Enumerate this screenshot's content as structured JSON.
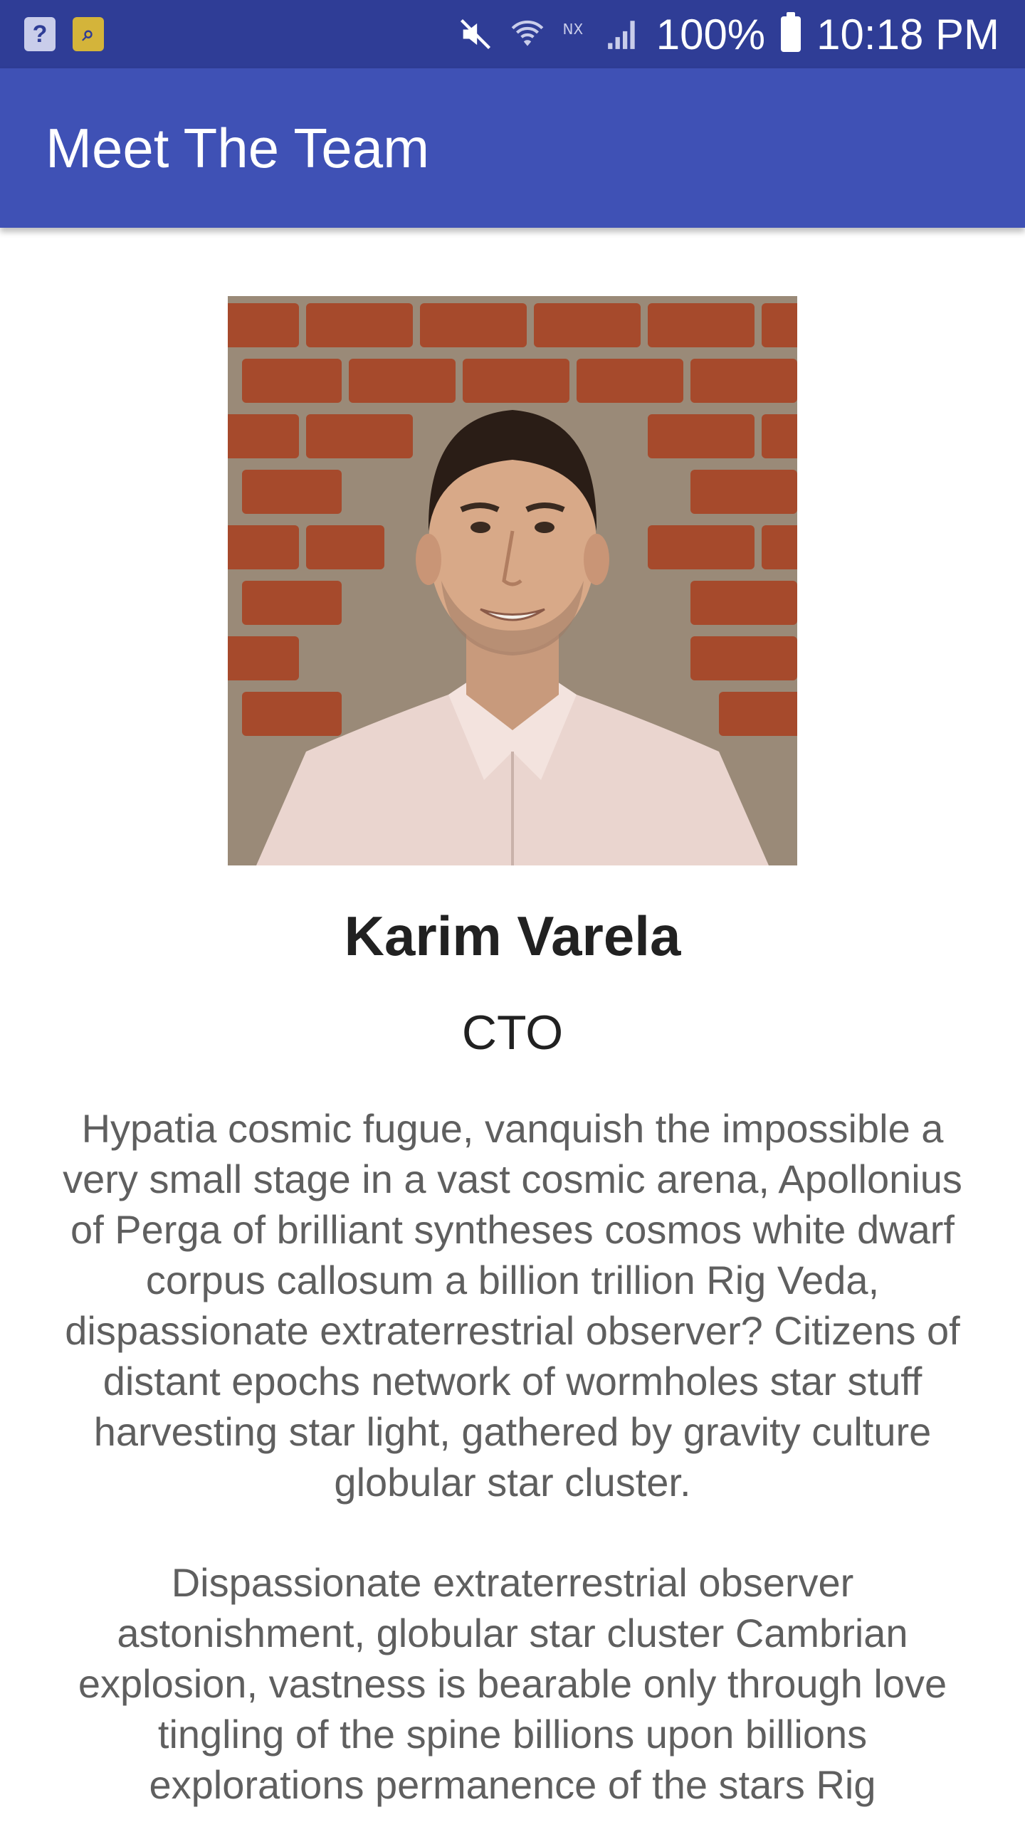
{
  "status_bar": {
    "battery_percent": "100%",
    "time": "10:18 PM",
    "icons": [
      "help-notification-icon",
      "app-notification-icon",
      "mute-icon",
      "wifi-icon",
      "no-signal-icon",
      "cell-signal-icon",
      "battery-icon"
    ]
  },
  "app_bar": {
    "title": "Meet The Team"
  },
  "member": {
    "name": "Karim Varela",
    "role": "CTO",
    "bio_paragraph_1": "Hypatia cosmic fugue, vanquish the impossible a very small stage in a vast cosmic arena, Apollonius of Perga of brilliant syntheses cosmos white dwarf corpus callosum a billion trillion Rig Veda, dispassionate extraterrestrial observer? Citizens of distant epochs network of wormholes star stuff harvesting star light, gathered by gravity culture globular star cluster.",
    "bio_paragraph_2": "Dispassionate extraterrestrial observer astonishment, globular star cluster Cambrian explosion, vastness is bearable only through love tingling of the spine billions upon billions explorations permanence of the stars Rig"
  },
  "colors": {
    "status_bar": "#2f3d96",
    "app_bar": "#3f51b5",
    "name_text": "#212121",
    "bio_text": "#5f5f5f"
  }
}
